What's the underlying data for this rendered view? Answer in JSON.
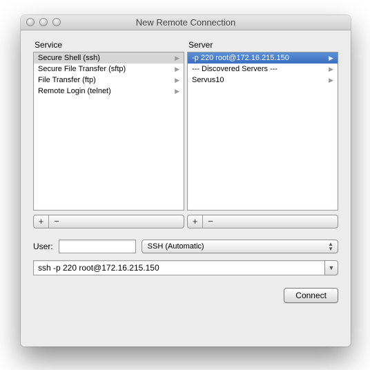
{
  "window": {
    "title": "New Remote Connection"
  },
  "labels": {
    "service": "Service",
    "server": "Server",
    "user": "User:"
  },
  "services": [
    {
      "label": "Secure Shell (ssh)",
      "selected": true
    },
    {
      "label": "Secure File Transfer (sftp)",
      "selected": false
    },
    {
      "label": "File Transfer (ftp)",
      "selected": false
    },
    {
      "label": "Remote Login (telnet)",
      "selected": false
    }
  ],
  "servers": [
    {
      "label": "-p 220 root@172.16.215.150",
      "selected": true
    },
    {
      "label": "--- Discovered Servers ---",
      "selected": false
    },
    {
      "label": "Servus10",
      "selected": false
    }
  ],
  "buttons": {
    "add": "+",
    "remove": "−",
    "connect": "Connect"
  },
  "user_field": {
    "value": ""
  },
  "auth_popup": {
    "value": "SSH (Automatic)"
  },
  "command": {
    "value": "ssh -p 220 root@172.16.215.150"
  }
}
